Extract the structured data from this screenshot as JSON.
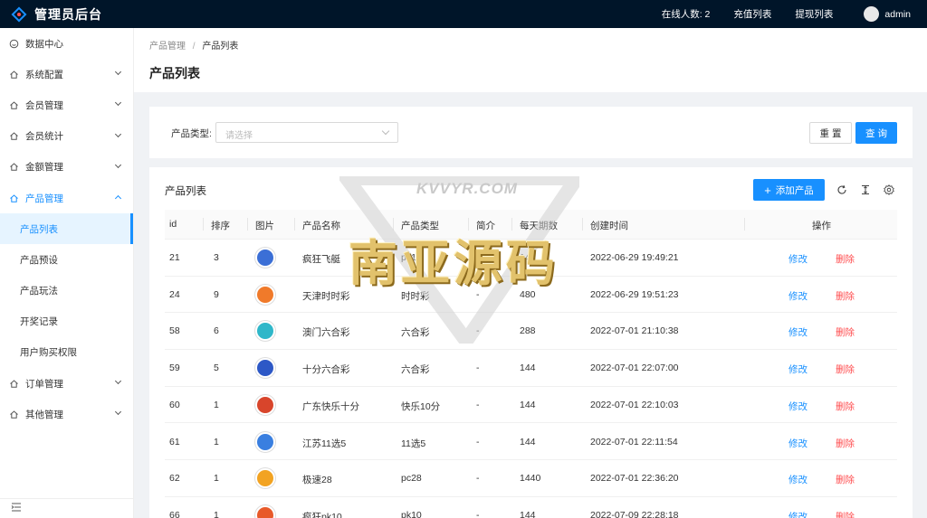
{
  "topbar": {
    "title": "管理员后台",
    "online": "在线人数: 2",
    "recharge": "充值列表",
    "withdraw": "提现列表",
    "user": "admin"
  },
  "sidebar": {
    "items": [
      {
        "label": "数据中心"
      },
      {
        "label": "系统配置"
      },
      {
        "label": "会员管理"
      },
      {
        "label": "会员统计"
      },
      {
        "label": "金额管理"
      },
      {
        "label": "产品管理"
      }
    ],
    "subitems": [
      {
        "label": "产品列表"
      },
      {
        "label": "产品预设"
      },
      {
        "label": "产品玩法"
      },
      {
        "label": "开奖记录"
      },
      {
        "label": "用户购买权限"
      }
    ],
    "items_after": [
      {
        "label": "订单管理"
      },
      {
        "label": "其他管理"
      }
    ]
  },
  "header": {
    "breadcrumb_parent": "产品管理",
    "breadcrumb_sep": "/",
    "breadcrumb_current": "产品列表",
    "title": "产品列表"
  },
  "filter": {
    "label": "产品类型:",
    "placeholder": "请选择",
    "reset": "重 置",
    "search": "查 询"
  },
  "table": {
    "title": "产品列表",
    "add_label": "添加产品",
    "add_symbol": "+",
    "columns": [
      "id",
      "排序",
      "图片",
      "产品名称",
      "产品类型",
      "简介",
      "每天期数",
      "创建时间",
      "操作"
    ],
    "edit_label": "修改",
    "delete_label": "删除",
    "rows": [
      {
        "id": "21",
        "sort": "3",
        "name": "疯狂飞艇",
        "type": "pk10",
        "intro": "-",
        "periods": "144",
        "created": "2022-06-29 19:49:21",
        "thumb_color": "#3b6fd6"
      },
      {
        "id": "24",
        "sort": "9",
        "name": "天津时时彩",
        "type": "时时彩",
        "intro": "-",
        "periods": "480",
        "created": "2022-06-29 19:51:23",
        "thumb_color": "#f07a2a"
      },
      {
        "id": "58",
        "sort": "6",
        "name": "澳门六合彩",
        "type": "六合彩",
        "intro": "-",
        "periods": "288",
        "created": "2022-07-01 21:10:38",
        "thumb_color": "#2fb7c9"
      },
      {
        "id": "59",
        "sort": "5",
        "name": "十分六合彩",
        "type": "六合彩",
        "intro": "-",
        "periods": "144",
        "created": "2022-07-01 22:07:00",
        "thumb_color": "#2d58c6"
      },
      {
        "id": "60",
        "sort": "1",
        "name": "广东快乐十分",
        "type": "快乐10分",
        "intro": "-",
        "periods": "144",
        "created": "2022-07-01 22:10:03",
        "thumb_color": "#d8452b"
      },
      {
        "id": "61",
        "sort": "1",
        "name": "江苏11选5",
        "type": "11选5",
        "intro": "-",
        "periods": "144",
        "created": "2022-07-01 22:11:54",
        "thumb_color": "#3a7fe0"
      },
      {
        "id": "62",
        "sort": "1",
        "name": "极速28",
        "type": "pc28",
        "intro": "-",
        "periods": "1440",
        "created": "2022-07-01 22:36:20",
        "thumb_color": "#f2a322"
      },
      {
        "id": "66",
        "sort": "1",
        "name": "疯狂pk10",
        "type": "pk10",
        "intro": "-",
        "periods": "144",
        "created": "2022-07-09 22:28:18",
        "thumb_color": "#e85a2a"
      }
    ]
  },
  "watermark": {
    "top": "KVVYR.COM",
    "main": "南亚源码"
  },
  "colors": {
    "primary": "#1890ff",
    "danger": "#ff4d4f",
    "topbar_bg": "#001529"
  }
}
